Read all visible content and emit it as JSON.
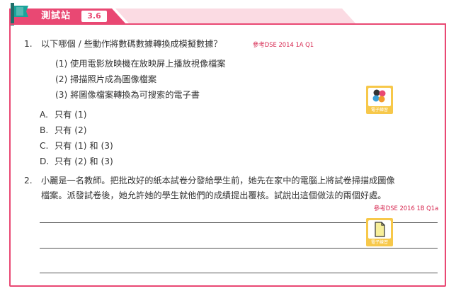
{
  "header": {
    "title": "測試站",
    "number": "3.6"
  },
  "q1": {
    "number": "1.",
    "question": "以下哪個 / 些動作將數碼數據轉換成模擬數據？",
    "reference": "參考DSE 2014 1A Q1",
    "items": [
      "(1)  使用電影放映機在放映屏上播放視像檔案",
      "(2)  掃描照片成為圖像檔案",
      "(3)  將圖像檔案轉換為可搜索的電子書"
    ],
    "options": [
      {
        "letter": "A.",
        "text": "只有 (1)"
      },
      {
        "letter": "B.",
        "text": "只有 (2)"
      },
      {
        "letter": "C.",
        "text": "只有 (1) 和 (3)"
      },
      {
        "letter": "D.",
        "text": "只有 (2) 和 (3)"
      }
    ],
    "icon_label": "電子練習"
  },
  "q2": {
    "number": "2.",
    "lines": [
      "小麗是一名教師。把批改好的紙本試卷分發給學生前，她先在家中的電腦上將試卷掃描成圖像",
      "檔案。派發試卷後，她允許她的學生就他們的成績提出覆核。試說出這個做法的兩個好處。"
    ],
    "reference": "參考DSE 2016 1B Q1a",
    "icon_label": "電子練習"
  },
  "colors": {
    "accent": "#e94873",
    "accent_light": "#fbdbe3",
    "flag_green": "#1aa39a",
    "icon_yellow": "#f7c84a"
  }
}
